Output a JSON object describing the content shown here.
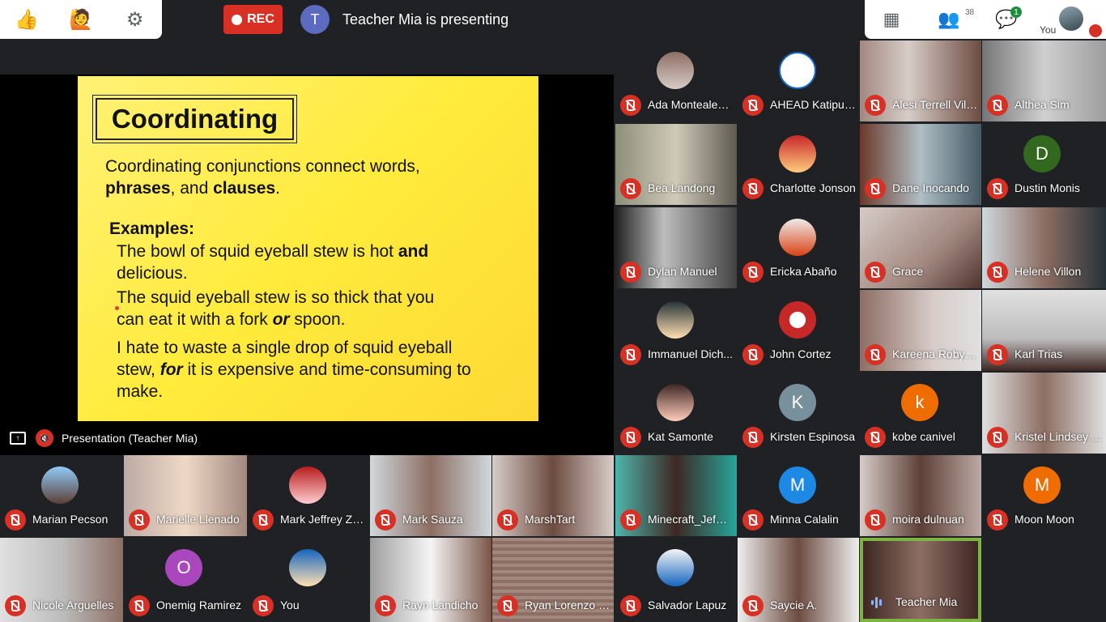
{
  "topbar": {
    "rec_label": "REC",
    "presenter_initial": "T",
    "presenter_text": "Teacher Mia is presenting",
    "participant_count": "38",
    "chat_badge": "1",
    "you_label": "You"
  },
  "icons": {
    "thumbs_up": "👍",
    "raise_hand": "🙋",
    "settings": "⚙",
    "grid": "▦",
    "people": "👥",
    "chat": "💬"
  },
  "slide": {
    "title": "Coordinating",
    "intro_1": "Coordinating conjunctions connect words,",
    "intro_2a": "phrases",
    "intro_2b": ", and ",
    "intro_2c": "clauses",
    "intro_2d": ".",
    "examples_label": "Examples:",
    "ex1a": "The bowl of squid eyeball stew is hot ",
    "ex1b": "and",
    "ex1c": "delicious.",
    "ex2a": "The squid eyeball stew is so thick that you",
    "ex2b": "can eat it with a fork ",
    "ex2c": "or",
    "ex2d": " spoon.",
    "ex3a": "I hate to waste a single drop of squid eyeball",
    "ex3b": "stew, ",
    "ex3c": "for",
    "ex3d": " it is expensive and time-consuming to",
    "ex3e": "make."
  },
  "presentation_bar": {
    "label": "Presentation (Teacher Mia)"
  },
  "participants": [
    {
      "name": "Ada Montealegre"
    },
    {
      "name": "AHEAD Katipun..."
    },
    {
      "name": "Alesi Terrell Vill..."
    },
    {
      "name": "Althea Sim"
    },
    {
      "name": "Bea Landong"
    },
    {
      "name": "Charlotte Jonson"
    },
    {
      "name": "Dane Inocando"
    },
    {
      "name": "Dustin Monis",
      "initial": "D"
    },
    {
      "name": "Dylan Manuel"
    },
    {
      "name": "Ericka Abaño"
    },
    {
      "name": "Grace"
    },
    {
      "name": "Helene Villon"
    },
    {
      "name": "Immanuel Dich..."
    },
    {
      "name": "John Cortez"
    },
    {
      "name": "Kareena Robyn ..."
    },
    {
      "name": "Karl Trias"
    },
    {
      "name": "Kat Samonte"
    },
    {
      "name": "Kirsten Espinosa",
      "initial": "K"
    },
    {
      "name": "kobe canivel",
      "initial": "k"
    },
    {
      "name": "Kristel Lindsey ..."
    },
    {
      "name": "Marian Pecson"
    },
    {
      "name": "Marielle Llenado"
    },
    {
      "name": "Mark Jeffrey Za..."
    },
    {
      "name": "Mark Sauza"
    },
    {
      "name": "MarshTart"
    },
    {
      "name": "Minecraft_Jef@..."
    },
    {
      "name": "Minna Calalin",
      "initial": "M"
    },
    {
      "name": "moira dulnuan"
    },
    {
      "name": "Moon Moon",
      "initial": "M"
    },
    {
      "name": "Nicole Arguelles"
    },
    {
      "name": "Onemig Ramirez",
      "initial": "O"
    },
    {
      "name": "You"
    },
    {
      "name": "Rayn Landicho"
    },
    {
      "name": "Ryan Lorenzo S..."
    },
    {
      "name": "Salvador Lapuz"
    },
    {
      "name": "Saycie A."
    },
    {
      "name": "Teacher Mia"
    }
  ],
  "colors": {
    "mute_red": "#d93025",
    "speaking_green": "#7cb342",
    "rec_red": "#d93025",
    "slide_yellow": "#ffeb3b"
  }
}
